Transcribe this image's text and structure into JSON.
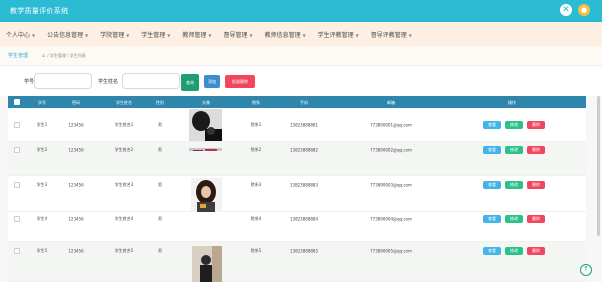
{
  "app": {
    "title": "教学质量评价系统",
    "close_icon": "close-icon",
    "user_icon": "user-icon"
  },
  "nav": {
    "items": [
      {
        "label": "个人中心",
        "icon": "chevron-down-icon"
      },
      {
        "label": "公告信息管理",
        "icon": "chevron-down-icon"
      },
      {
        "label": "学院管理",
        "icon": "chevron-down-icon"
      },
      {
        "label": "学生管理",
        "icon": "chevron-down-icon"
      },
      {
        "label": "教师管理",
        "icon": "chevron-down-icon"
      },
      {
        "label": "督导管理",
        "icon": "chevron-down-icon"
      },
      {
        "label": "教师信息管理",
        "icon": "chevron-down-icon"
      },
      {
        "label": "学生评教管理",
        "icon": "chevron-down-icon"
      },
      {
        "label": "督导评教管理",
        "icon": "chevron-down-icon"
      }
    ]
  },
  "breadcrumb": {
    "title": "学生管理",
    "path": "/ 学生管理 / 学生列表"
  },
  "filter": {
    "student_id_label": "学号",
    "student_id_value": "",
    "student_name_label": "学生姓名",
    "student_name_value": "",
    "search_label": "查询",
    "add_label": "添加",
    "batch_delete_label": "批量删除"
  },
  "table": {
    "columns": [
      "学号",
      "密码",
      "学生姓名",
      "性别",
      "头像",
      "院系",
      "手机",
      "邮箱",
      "操作"
    ],
    "rows": [
      {
        "id": "学生1",
        "password": "123456",
        "name": "学生姓名1",
        "gender": "男",
        "dept": "院系1",
        "phone": "13823888881",
        "email": "773890001@qq.com"
      },
      {
        "id": "学生2",
        "password": "123456",
        "name": "学生姓名2",
        "gender": "男",
        "dept": "院系2",
        "phone": "13823888882",
        "email": "773890002@qq.com"
      },
      {
        "id": "学生3",
        "password": "123456",
        "name": "学生姓名3",
        "gender": "男",
        "dept": "院系3",
        "phone": "13823888883",
        "email": "773890003@qq.com"
      },
      {
        "id": "学生4",
        "password": "123456",
        "name": "学生姓名4",
        "gender": "男",
        "dept": "院系4",
        "phone": "13823888884",
        "email": "773890004@qq.com"
      },
      {
        "id": "学生5",
        "password": "123456",
        "name": "学生姓名5",
        "gender": "男",
        "dept": "院系5",
        "phone": "13823888885",
        "email": "773890005@qq.com"
      }
    ],
    "actions": {
      "view": "查看",
      "edit": "修改",
      "delete": "删除"
    }
  },
  "colors": {
    "topbar": "#2bbbd3",
    "nav_bg": "#fdf0e2",
    "table_header": "#2f86ad",
    "view": "#43b4e8",
    "edit": "#2cc08a",
    "delete": "#f0465f"
  }
}
